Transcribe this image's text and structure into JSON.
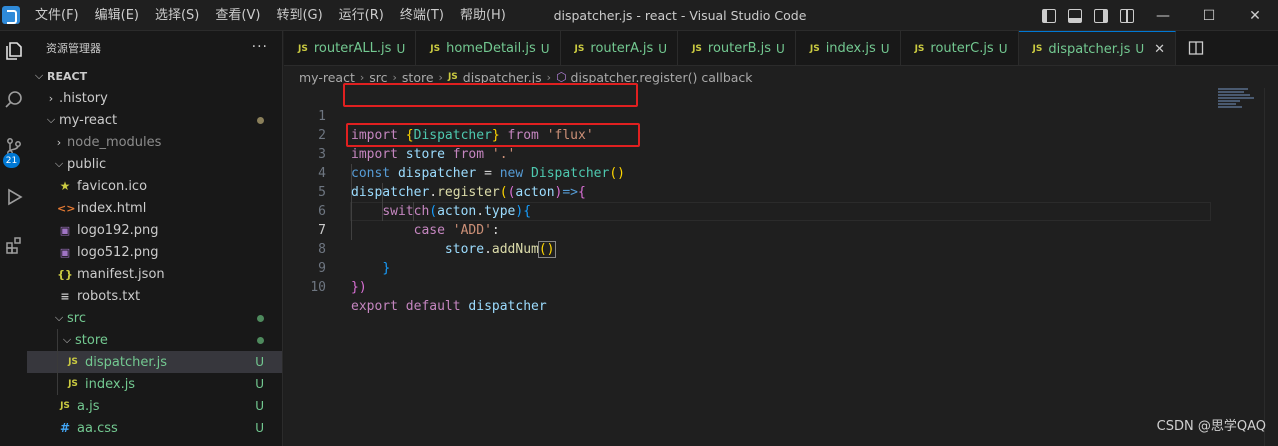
{
  "titlebar": {
    "menu": [
      "文件(F)",
      "编辑(E)",
      "选择(S)",
      "查看(V)",
      "转到(G)",
      "运行(R)",
      "终端(T)",
      "帮助(H)"
    ],
    "title": "dispatcher.js - react - Visual Studio Code",
    "win_buttons": [
      "—",
      "☐",
      "✕"
    ]
  },
  "activity": {
    "items": [
      "explorer-icon",
      "search-icon",
      "source-control-icon",
      "run-debug-icon",
      "extensions-icon"
    ],
    "scm_badge": "21"
  },
  "sidebar": {
    "header": "资源管理器",
    "more": "···",
    "root": "REACT",
    "rows": [
      {
        "label": ".history",
        "type": "folder-closed"
      },
      {
        "label": "my-react",
        "type": "folder-open"
      },
      {
        "label": "node_modules",
        "type": "folder-closed"
      },
      {
        "label": "public",
        "type": "folder-open"
      },
      {
        "label": "favicon.ico",
        "type": "file"
      },
      {
        "label": "index.html",
        "type": "file"
      },
      {
        "label": "logo192.png",
        "type": "file"
      },
      {
        "label": "logo512.png",
        "type": "file"
      },
      {
        "label": "manifest.json",
        "type": "file"
      },
      {
        "label": "robots.txt",
        "type": "file"
      },
      {
        "label": "src",
        "type": "folder-open"
      },
      {
        "label": "store",
        "type": "folder-open"
      },
      {
        "label": "dispatcher.js",
        "type": "file",
        "badge": "U"
      },
      {
        "label": "index.js",
        "type": "file",
        "badge": "U"
      },
      {
        "label": "a.js",
        "type": "file",
        "badge": "U"
      },
      {
        "label": "aa.css",
        "type": "file",
        "badge": "U"
      }
    ]
  },
  "tabs": [
    {
      "label": "routerALL.js",
      "badge": "U"
    },
    {
      "label": "homeDetail.js",
      "badge": "U"
    },
    {
      "label": "routerA.js",
      "badge": "U"
    },
    {
      "label": "routerB.js",
      "badge": "U"
    },
    {
      "label": "index.js",
      "badge": "U"
    },
    {
      "label": "routerC.js",
      "badge": "U"
    },
    {
      "label": "dispatcher.js",
      "badge": "U",
      "active": true
    }
  ],
  "tab_js_label": "JS",
  "close_glyph": "✕",
  "breadcrumb": {
    "parts": [
      "my-react",
      "src",
      "store",
      "dispatcher.js",
      "dispatcher.register() callback"
    ]
  },
  "editor": {
    "line_numbers": [
      "1",
      "2",
      "3",
      "4",
      "5",
      "6",
      "7",
      "8",
      "9",
      "10"
    ],
    "current_line": 7,
    "code": {
      "l1": [
        "import ",
        "{",
        "Dispatcher",
        "}",
        " from ",
        "'flux'"
      ],
      "l2": [
        "import ",
        "store",
        " from ",
        "'.'"
      ],
      "l3": [
        "const ",
        "dispatcher",
        " = ",
        "new ",
        "Dispatcher",
        "()"
      ],
      "l4": [
        "dispatcher",
        ".",
        "register",
        "(",
        "(",
        "acton",
        ")",
        "=>",
        "{"
      ],
      "l5": [
        "switch",
        "(",
        "acton",
        ".",
        "type",
        ")",
        "{"
      ],
      "l6": [
        "case ",
        "'ADD'",
        ":"
      ],
      "l7": [
        "store",
        ".",
        "addNum",
        "()"
      ],
      "l8": [
        "}"
      ],
      "l9": [
        "})"
      ],
      "l10": [
        "export ",
        "default ",
        "dispatcher"
      ]
    }
  },
  "watermark": "CSDN @思学QAQ"
}
